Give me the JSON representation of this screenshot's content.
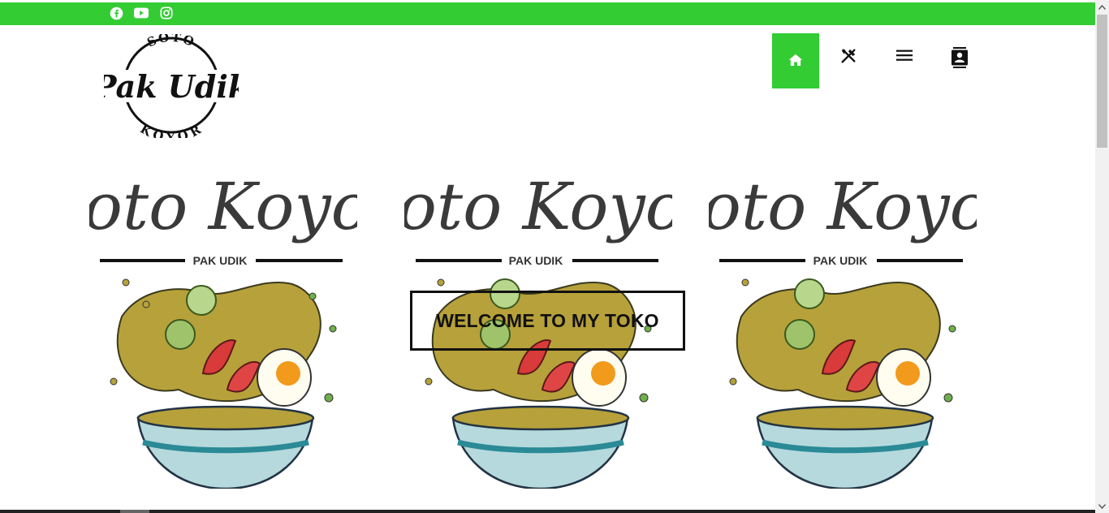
{
  "topbar": {
    "color": "#33cc33",
    "social_icons": [
      "facebook-icon",
      "youtube-icon",
      "instagram-icon"
    ]
  },
  "logo": {
    "top_text": "SOTO",
    "main_text": "Pak Udik",
    "bottom_text": "KOYOR"
  },
  "nav": {
    "items": [
      {
        "name": "home",
        "icon": "home-icon",
        "active": true
      },
      {
        "name": "menu",
        "icon": "fork-knife-icon",
        "active": false
      },
      {
        "name": "list",
        "icon": "hamburger-icon",
        "active": false
      },
      {
        "name": "contact",
        "icon": "contact-icon",
        "active": false
      }
    ],
    "active_color": "#33cc33"
  },
  "cards": [
    {
      "title": "Soto Koyor",
      "subtitle": "PAK UDIK"
    },
    {
      "title": "Soto Koyor",
      "subtitle": "PAK UDIK"
    },
    {
      "title": "Soto Koyor",
      "subtitle": "PAK UDIK"
    }
  ],
  "welcome": {
    "text": "WELCOME TO MY TOKO"
  }
}
